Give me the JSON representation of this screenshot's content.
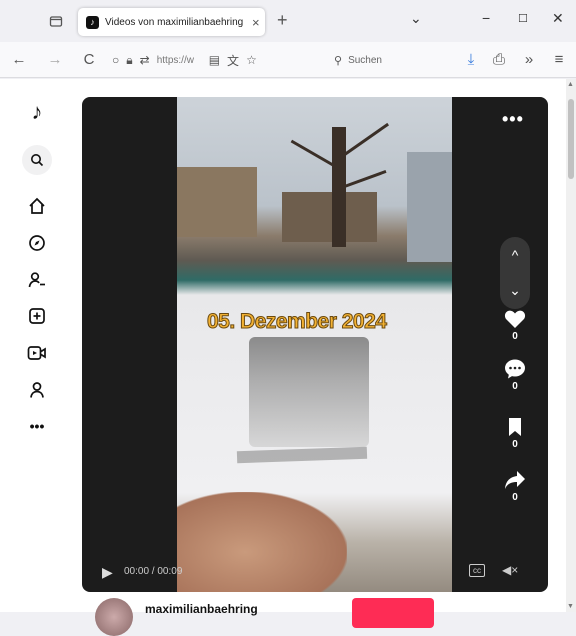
{
  "browser": {
    "tab": {
      "title": "Videos von maximilianbaehring",
      "favicon": "tiktok-icon",
      "close": "×"
    },
    "new_tab": "+",
    "tab_list": "⌄",
    "window_controls": {
      "minimize": "−",
      "maximize": "☐",
      "close": "✕"
    },
    "nav": {
      "back": "←",
      "forward": "→",
      "reload": "C"
    },
    "url_text": "https://w",
    "search_placeholder": "Suchen",
    "toolbar_icons": [
      "download-icon",
      "extensions-icon",
      "overflow-icon",
      "menu-icon"
    ]
  },
  "sidebar": {
    "items": [
      {
        "name": "tiktok-logo",
        "glyph": "♪"
      },
      {
        "name": "search-icon",
        "glyph": "⌕"
      },
      {
        "name": "home-icon",
        "glyph": "⌂"
      },
      {
        "name": "explore-icon",
        "glyph": "⊘"
      },
      {
        "name": "following-icon",
        "glyph": "⚇"
      },
      {
        "name": "upload-icon",
        "glyph": "⊞"
      },
      {
        "name": "live-icon",
        "glyph": "▣"
      },
      {
        "name": "profile-icon",
        "glyph": "⚲"
      },
      {
        "name": "more-icon",
        "glyph": "•••"
      }
    ]
  },
  "video": {
    "date_overlay": "05. Dezember 2024",
    "more": "•••",
    "arrow_up": "^",
    "arrow_down": "⌄",
    "actions": [
      {
        "name": "like-button",
        "icon": "heart-icon",
        "glyph": "♥",
        "count": "0"
      },
      {
        "name": "comment-button",
        "icon": "comment-icon",
        "glyph": "●",
        "count": "0"
      },
      {
        "name": "bookmark-button",
        "icon": "bookmark-icon",
        "glyph": "▮",
        "count": "0"
      },
      {
        "name": "share-button",
        "icon": "share-icon",
        "glyph": "➦",
        "count": "0"
      }
    ],
    "controls": {
      "play": "▶",
      "time": "00:00 / 00:09",
      "cc": "cc",
      "mute": "◀×"
    }
  },
  "author": {
    "name": "maximilianbaehring"
  },
  "colors": {
    "follow": "#fe2c55",
    "overlay_text": "#f3b233"
  }
}
